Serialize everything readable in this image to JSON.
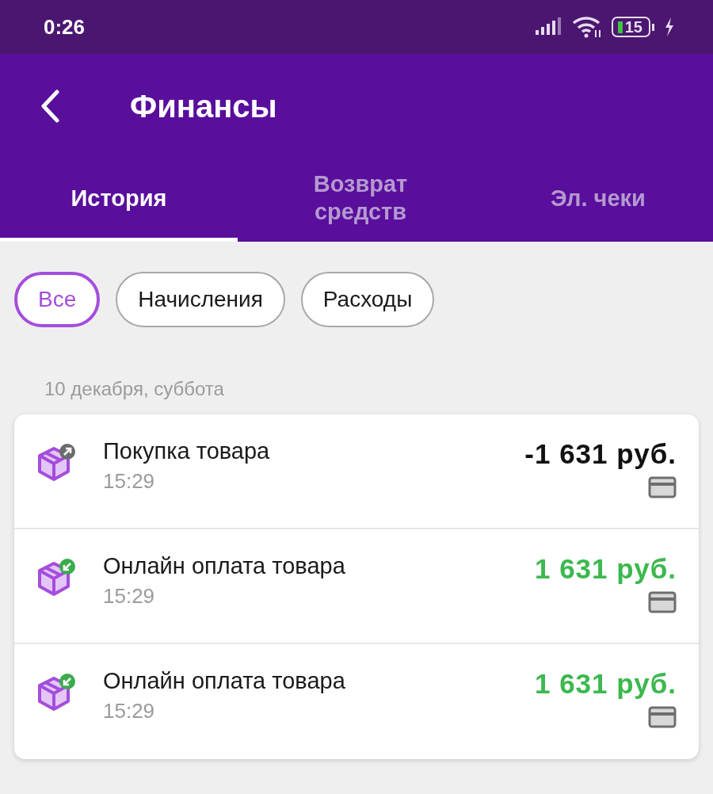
{
  "status_bar": {
    "time": "0:26",
    "battery": "15"
  },
  "header": {
    "title": "Финансы"
  },
  "tabs": [
    {
      "label": "История",
      "selected": true
    },
    {
      "label": "Возврат средств",
      "selected": false
    },
    {
      "label": "Эл. чеки",
      "selected": false
    }
  ],
  "filters": [
    {
      "label": "Все",
      "selected": true
    },
    {
      "label": "Начисления",
      "selected": false
    },
    {
      "label": "Расходы",
      "selected": false
    }
  ],
  "date": "10 декабря, суббота",
  "transactions": [
    {
      "kind": "expense",
      "title": "Покупка товара",
      "time": "15:29",
      "amount": "-1 631 руб."
    },
    {
      "kind": "income",
      "title": "Онлайн оплата товара",
      "time": "15:29",
      "amount": "1 631 руб."
    },
    {
      "kind": "income",
      "title": "Онлайн оплата товара",
      "time": "15:29",
      "amount": "1 631 руб."
    }
  ]
}
